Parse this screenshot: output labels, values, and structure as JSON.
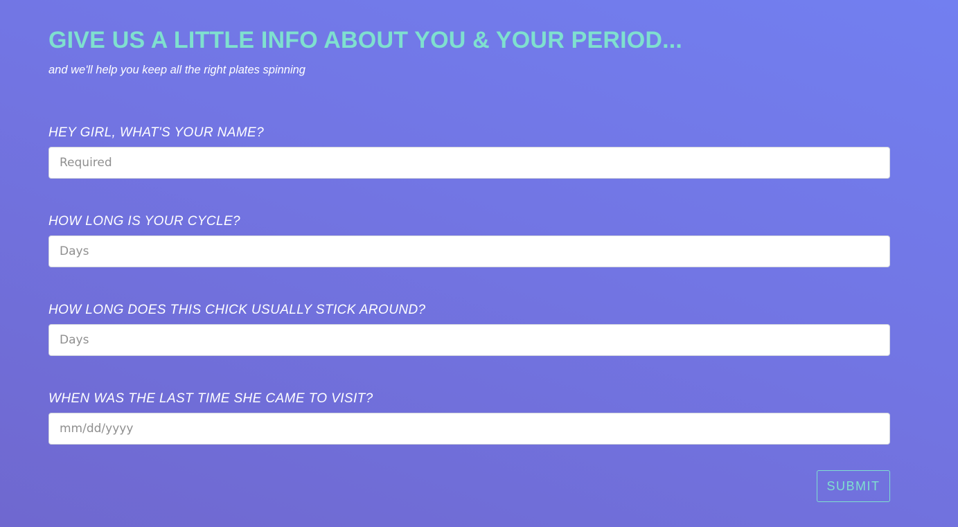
{
  "header": {
    "title": "GIVE US A LITTLE INFO ABOUT YOU & YOUR PERIOD...",
    "subtitle": "and we'll help you keep all the right plates spinning"
  },
  "form": {
    "name": {
      "label": "HEY GIRL, WHAT'S YOUR NAME?",
      "placeholder": "Required",
      "value": ""
    },
    "cycle_length": {
      "label": "HOW LONG IS YOUR CYCLE?",
      "placeholder": "Days",
      "value": ""
    },
    "period_length": {
      "label": "HOW LONG DOES THIS CHICK USUALLY STICK AROUND?",
      "placeholder": "Days",
      "value": ""
    },
    "last_period": {
      "label": "WHEN WAS THE LAST TIME SHE CAME TO VISIT?",
      "placeholder": "mm/dd/yyyy",
      "value": ""
    },
    "submit_label": "SUBMIT"
  },
  "colors": {
    "accent": "#7fe0cf",
    "background_start": "#727ff0",
    "background_end": "#6f68cf",
    "text": "#ffffff"
  }
}
